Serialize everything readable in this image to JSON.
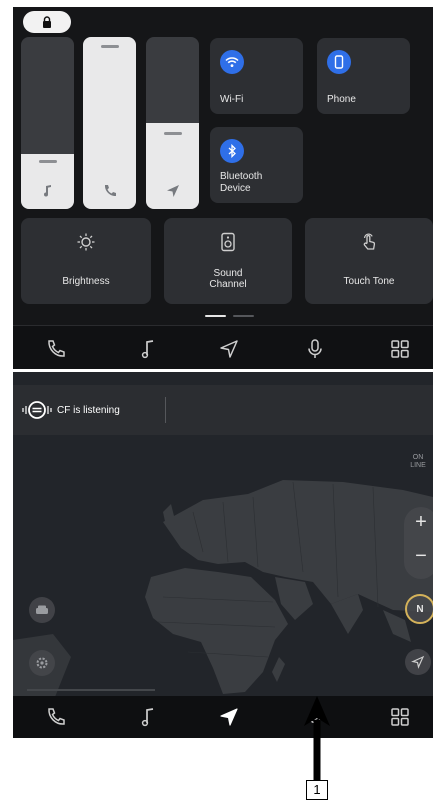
{
  "panel1": {
    "lock_icon": "lock-icon",
    "sliders": [
      {
        "name": "media-volume",
        "icon": "music-note-icon",
        "level": 0.32
      },
      {
        "name": "phone-volume",
        "icon": "phone-icon",
        "level": 1.0
      },
      {
        "name": "navigation-volume",
        "icon": "navigation-arrow-icon",
        "level": 0.5
      }
    ],
    "tiles": {
      "wifi": {
        "label": "Wi-Fi",
        "icon": "wifi-icon"
      },
      "phone": {
        "label": "Phone",
        "icon": "smartphone-icon"
      },
      "bluetooth": {
        "label_line1": "Bluetooth",
        "label_line2": "Device",
        "icon": "bluetooth-icon"
      }
    },
    "big_tiles": {
      "brightness": {
        "label": "Brightness",
        "icon": "brightness-icon"
      },
      "sound_channel": {
        "label_line1": "Sound",
        "label_line2": "Channel",
        "icon": "speaker-icon"
      },
      "touch_tone": {
        "label": "Touch Tone",
        "icon": "touch-hand-icon"
      }
    },
    "page_indicator": {
      "pages": 2,
      "active": 1
    },
    "accent": "#2f6fe8"
  },
  "nav": {
    "items": [
      "phone-icon",
      "music-note-icon",
      "navigation-arrow-icon",
      "microphone-icon",
      "apps-grid-icon"
    ]
  },
  "panel2": {
    "listening_text": "CF is listening",
    "online_badge": "ON LINE",
    "zoom_in": "+",
    "zoom_out": "−",
    "compass": "N"
  },
  "callout": {
    "label": "1"
  }
}
